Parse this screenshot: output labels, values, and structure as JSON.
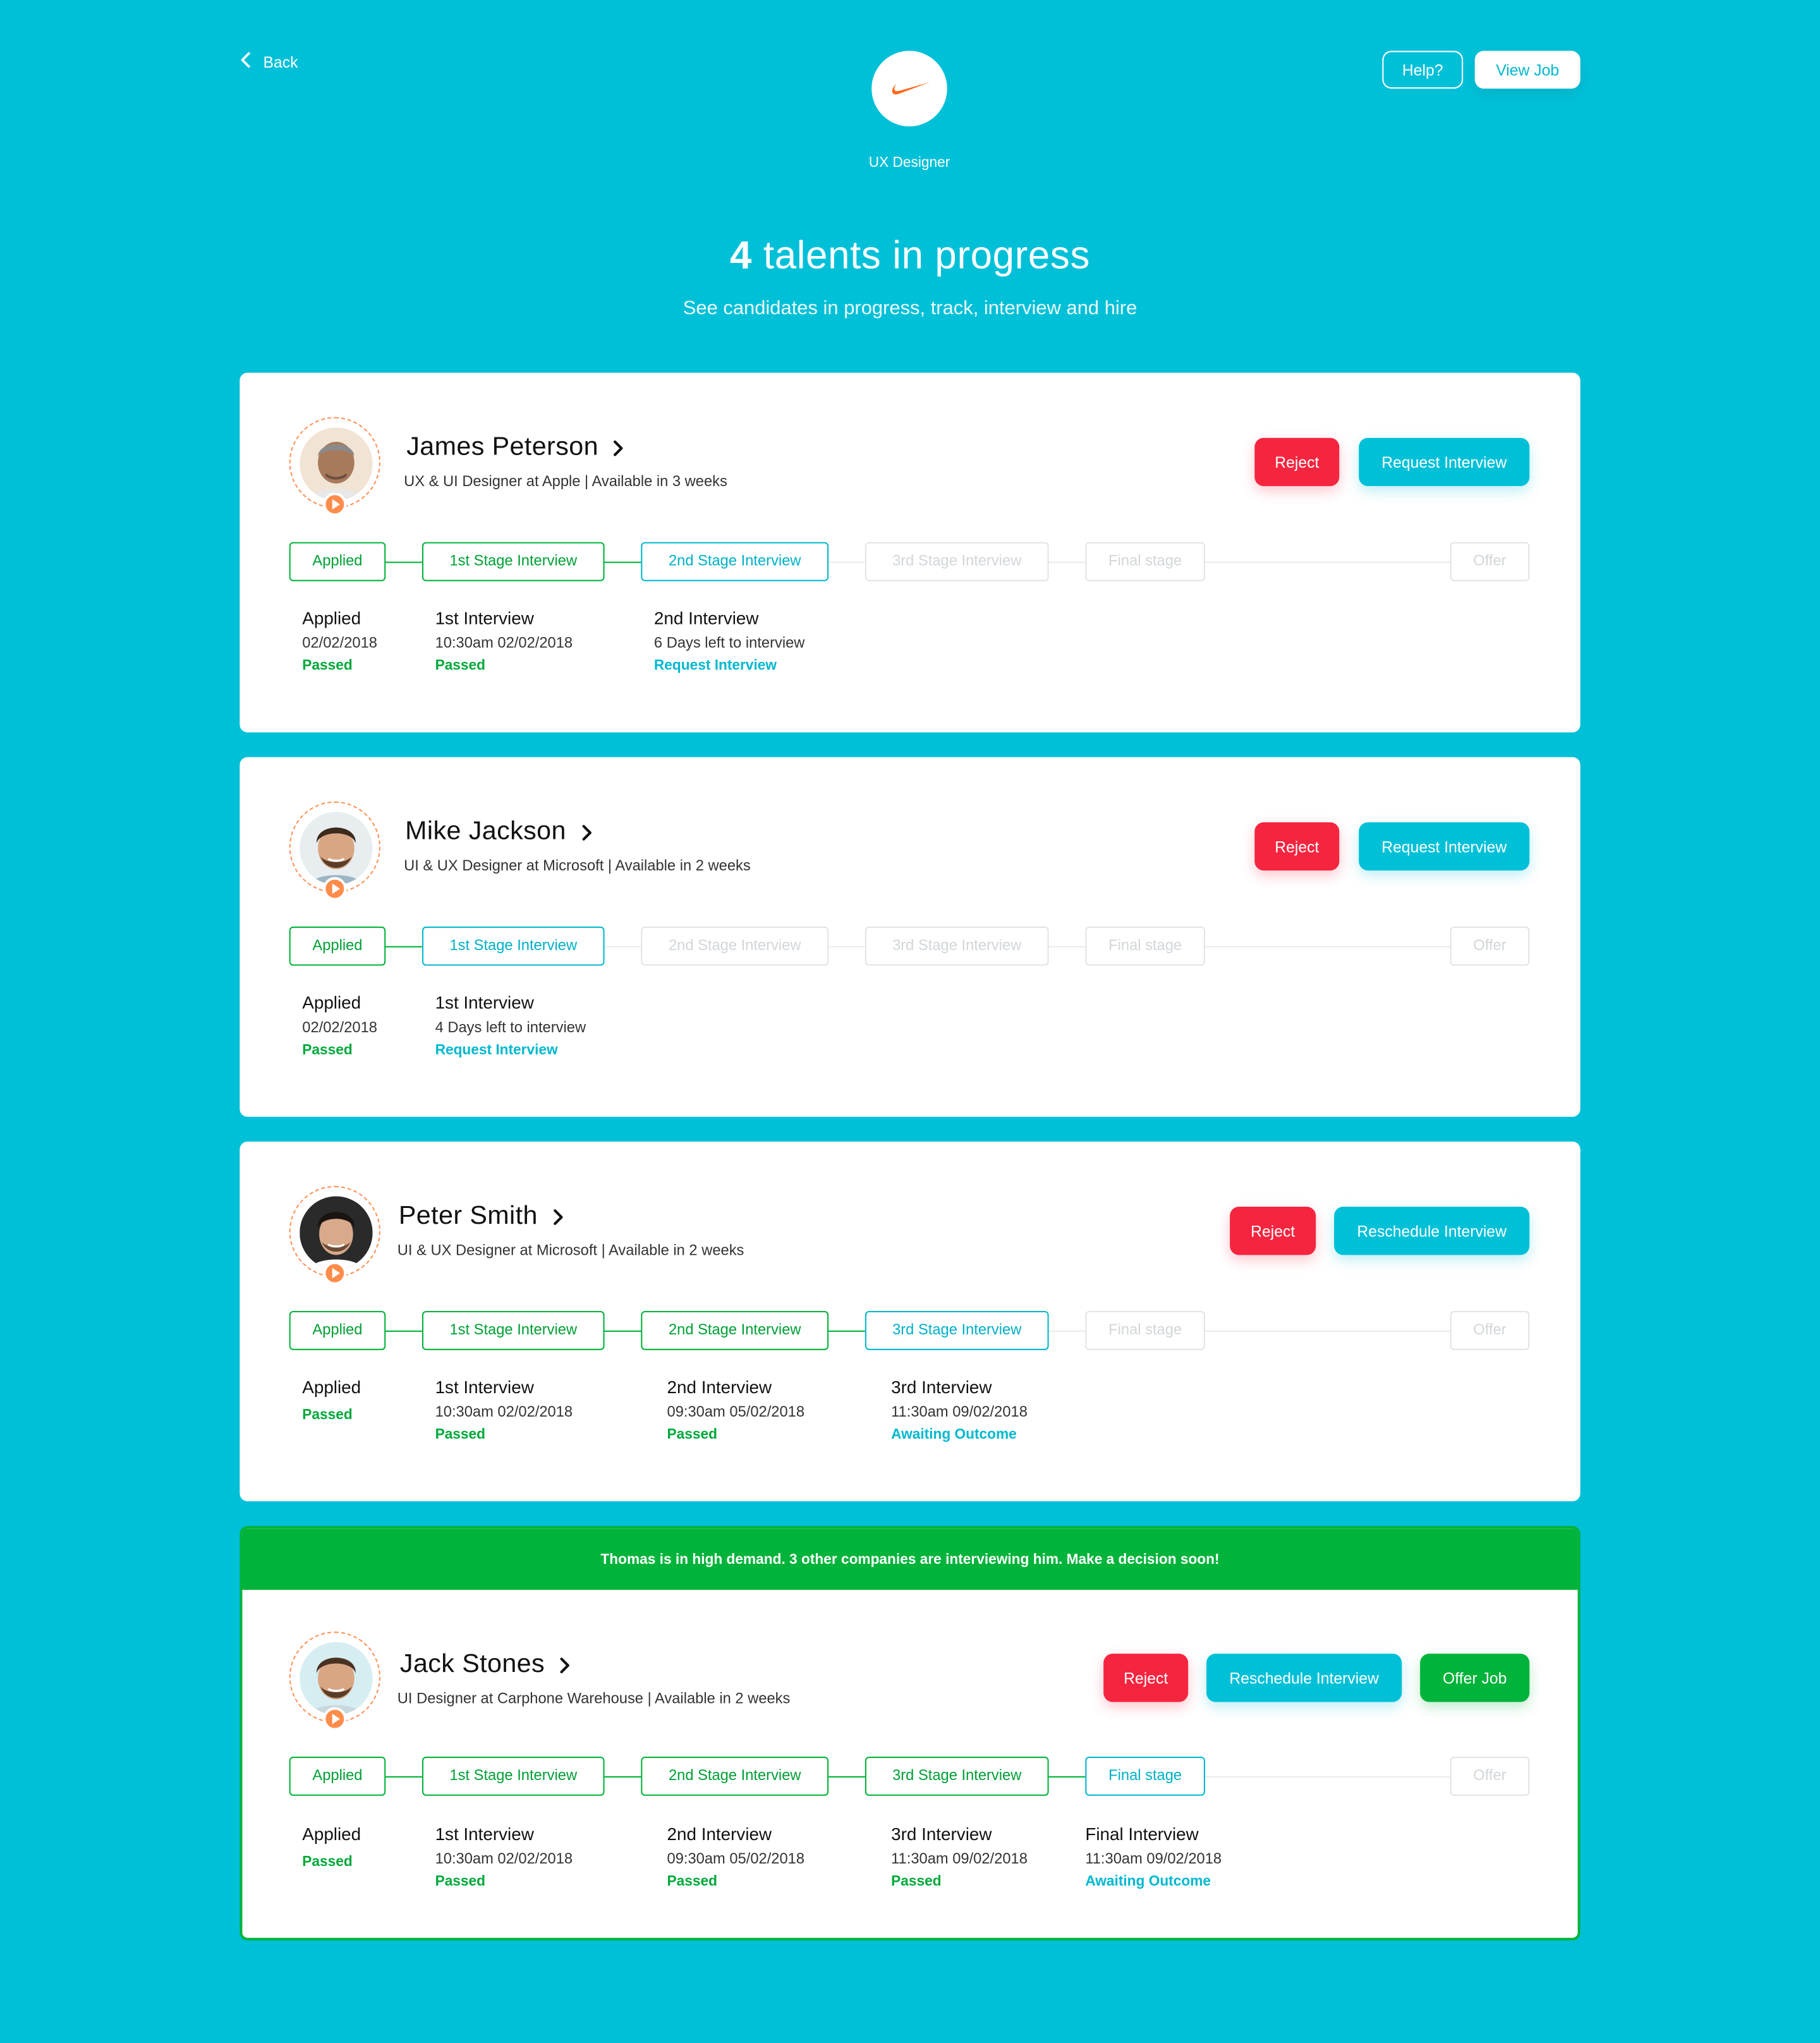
{
  "header": {
    "back_label": "Back",
    "job_title": "UX Designer",
    "help_label": "Help?",
    "view_job_label": "View Job",
    "title_count": "4",
    "title_text": "talents in progress",
    "subtitle": "See candidates in progress, track, interview and hire"
  },
  "colors": {
    "background": "#00c0d8",
    "reject": "#f5253f",
    "primary": "#00c0d8",
    "success": "#00b33a",
    "avatar_ring": "#ff9155"
  },
  "stages": [
    "Applied",
    "1st Stage Interview",
    "2nd Stage Interview",
    "3rd Stage Interview",
    "Final stage",
    "Offer"
  ],
  "candidates": [
    {
      "name": "James Peterson",
      "role": "UX & UI Designer at Apple  |  Available in 3 weeks",
      "reject_label": "Reject",
      "action_label": "Request Interview",
      "stage_states": [
        "done",
        "done",
        "current",
        "todo",
        "todo",
        "todo"
      ],
      "details": [
        {
          "heading": "Applied",
          "date": "02/02/2018",
          "status": "Passed"
        },
        {
          "heading": "1st Interview",
          "date": "10:30am 02/02/2018",
          "status": "Passed"
        },
        {
          "heading": "2nd Interview",
          "date": "6 Days left to interview",
          "status": "Request Interview"
        }
      ]
    },
    {
      "name": "Mike Jackson",
      "role": "UI & UX Designer at Microsoft  |  Available in 2 weeks",
      "reject_label": "Reject",
      "action_label": "Request Interview",
      "stage_states": [
        "done",
        "current",
        "todo",
        "todo",
        "todo",
        "todo"
      ],
      "details": [
        {
          "heading": "Applied",
          "date": "02/02/2018",
          "status": "Passed"
        },
        {
          "heading": "1st Interview",
          "date": "4 Days left to interview",
          "status": "Request Interview"
        }
      ]
    },
    {
      "name": "Peter Smith",
      "role": "UI & UX Designer at Microsoft  |  Available in 2 weeks",
      "reject_label": "Reject",
      "action_label": "Reschedule Interview",
      "stage_states": [
        "done",
        "done",
        "done",
        "current",
        "todo",
        "todo"
      ],
      "details": [
        {
          "heading": "Applied",
          "status": "Passed"
        },
        {
          "heading": "1st Interview",
          "date": "10:30am 02/02/2018",
          "status": "Passed"
        },
        {
          "heading": "2nd Interview",
          "date": "09:30am 05/02/2018",
          "status": "Passed"
        },
        {
          "heading": "3rd Interview",
          "date": "11:30am 09/02/2018",
          "status": "Awaiting Outcome"
        }
      ]
    },
    {
      "banner": "Thomas is in high demand. 3 other companies are interviewing him. Make a decision soon!",
      "name": "Jack Stones",
      "role": "UI Designer at Carphone Warehouse  |  Available in 2 weeks",
      "reject_label": "Reject",
      "action_label": "Reschedule Interview",
      "offer_label": "Offer Job",
      "stage_states": [
        "done",
        "done",
        "done",
        "done",
        "current",
        "todo"
      ],
      "details": [
        {
          "heading": "Applied",
          "status": "Passed"
        },
        {
          "heading": "1st Interview",
          "date": "10:30am 02/02/2018",
          "status": "Passed"
        },
        {
          "heading": "2nd Interview",
          "date": "09:30am 05/02/2018",
          "status": "Passed"
        },
        {
          "heading": "3rd Interview",
          "date": "11:30am 09/02/2018",
          "status": "Passed"
        },
        {
          "heading": "Final Interview",
          "date": "11:30am 09/02/2018",
          "status": "Awaiting Outcome"
        }
      ]
    }
  ]
}
